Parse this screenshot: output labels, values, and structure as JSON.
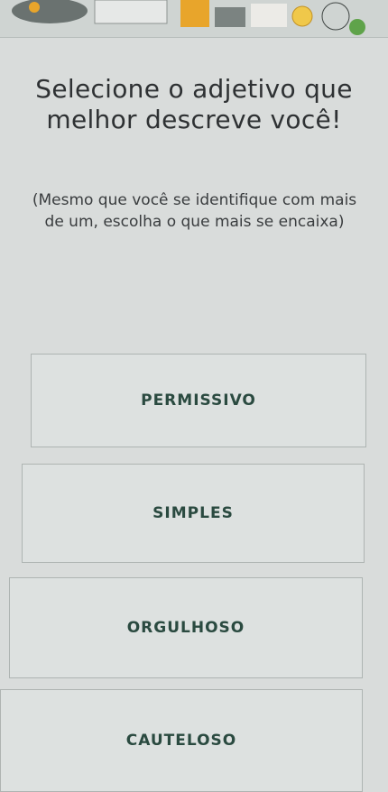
{
  "question": {
    "title": "Selecione o adjetivo que melhor descreve você!",
    "hint": "(Mesmo que você se identifique com mais de um, escolha o que mais se encaixa)"
  },
  "options": [
    {
      "label": "PERMISSIVO"
    },
    {
      "label": "SIMPLES"
    },
    {
      "label": "ORGULHOSO"
    },
    {
      "label": "CAUTELOSO"
    }
  ],
  "colors": {
    "background": "#d9dcdb",
    "option_text": "#2a4a40",
    "illustration_orange": "#e8a52b",
    "illustration_green": "#5fa34a"
  }
}
